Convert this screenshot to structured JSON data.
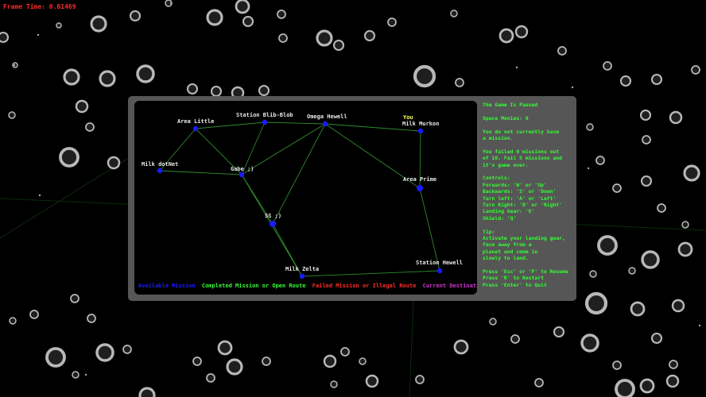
{
  "hud": {
    "frame_time": "Frame Time: 0.01469"
  },
  "map": {
    "nodes": [
      {
        "id": "area_little",
        "label": "Area Little"
      },
      {
        "id": "station_blib",
        "label": "Station Blib-Blob"
      },
      {
        "id": "omega_hewell",
        "label": "Omega Hewell"
      },
      {
        "id": "milk_murkon",
        "label": "Milk Murkon",
        "you": "You"
      },
      {
        "id": "milk_dotnet",
        "label": "Milk dotNet"
      },
      {
        "id": "gabe",
        "label": "Gabe ;)"
      },
      {
        "id": "area_prime",
        "label": "Area Prime"
      },
      {
        "id": "ss",
        "label": "SS ;)"
      },
      {
        "id": "milk_zelta",
        "label": "Milk Zelta"
      },
      {
        "id": "station_hewell",
        "label": "Station Hewell"
      }
    ],
    "routes": [
      [
        "milk_dotnet",
        "area_little"
      ],
      [
        "milk_dotnet",
        "gabe"
      ],
      [
        "area_little",
        "gabe"
      ],
      [
        "area_little",
        "station_blib"
      ],
      [
        "station_blib",
        "omega_hewell"
      ],
      [
        "station_blib",
        "gabe"
      ],
      [
        "omega_hewell",
        "gabe"
      ],
      [
        "omega_hewell",
        "milk_murkon"
      ],
      [
        "omega_hewell",
        "area_prime"
      ],
      [
        "omega_hewell",
        "ss"
      ],
      [
        "milk_murkon",
        "area_prime"
      ],
      [
        "gabe",
        "ss"
      ],
      [
        "gabe",
        "milk_zelta"
      ],
      [
        "ss",
        "milk_zelta"
      ],
      [
        "area_prime",
        "station_hewell"
      ],
      [
        "milk_zelta",
        "station_hewell"
      ]
    ],
    "colors": {
      "route": "#2e8b2e",
      "available": "#1a1aff",
      "completed": "#33ff33",
      "failed": "#ff2a2a",
      "destination": "#cc33cc"
    },
    "legend": {
      "available": "Available Mission",
      "completed": "Completed Mission or Open Route",
      "failed": "Failed Mission or Illegal Route",
      "destination": "Current Destination"
    }
  },
  "info": {
    "paused": "The Game Is Paused",
    "money": "Space Monies: 0",
    "mission": "You do not currently have\na mission.",
    "failed": "You failed 0 missions out\nof 10. Fail 5 missions and\nit's game over.",
    "controls_title": "Controls:",
    "controls": [
      "Forwards: 'W' or 'Up'",
      "Backwards: 'S' or 'Down'",
      "Turn left: 'A' or 'Left'",
      "Turn Right: 'D' or 'Right'",
      "Landing Gear: 'E'",
      "Shield: 'Q'"
    ],
    "tip_title": "Tip:",
    "tip": "Activate your landing gear,\nface away from a\nplanet and come in\nslowly to land.",
    "keys": [
      "Press 'Esc' or 'P' to Resume",
      "Press 'R' to Restart",
      "Press 'Enter' to Quit"
    ]
  }
}
